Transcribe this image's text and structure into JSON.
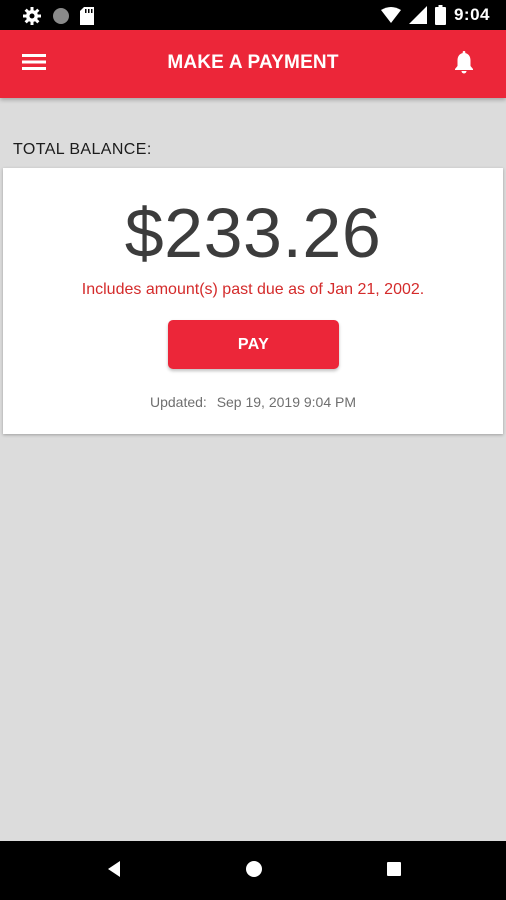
{
  "status_bar": {
    "time": "9:04",
    "icons": [
      "gear-icon",
      "circle-icon",
      "sd-card-icon",
      "wifi-icon",
      "signal-icon",
      "battery-icon"
    ]
  },
  "app_bar": {
    "title": "MAKE A PAYMENT",
    "menu_icon": "hamburger-menu-icon",
    "notification_icon": "bell-icon",
    "color": "#ec2639"
  },
  "balance": {
    "label": "TOTAL BALANCE:",
    "amount": "$233.26",
    "past_due_notice": "Includes amount(s) past due as of Jan 21, 2002.",
    "pay_button_label": "PAY",
    "updated_label": "Updated:",
    "updated_value": "Sep 19, 2019 9:04 PM"
  },
  "nav_bar": {
    "buttons": [
      "back-icon",
      "home-icon",
      "recents-icon"
    ]
  }
}
